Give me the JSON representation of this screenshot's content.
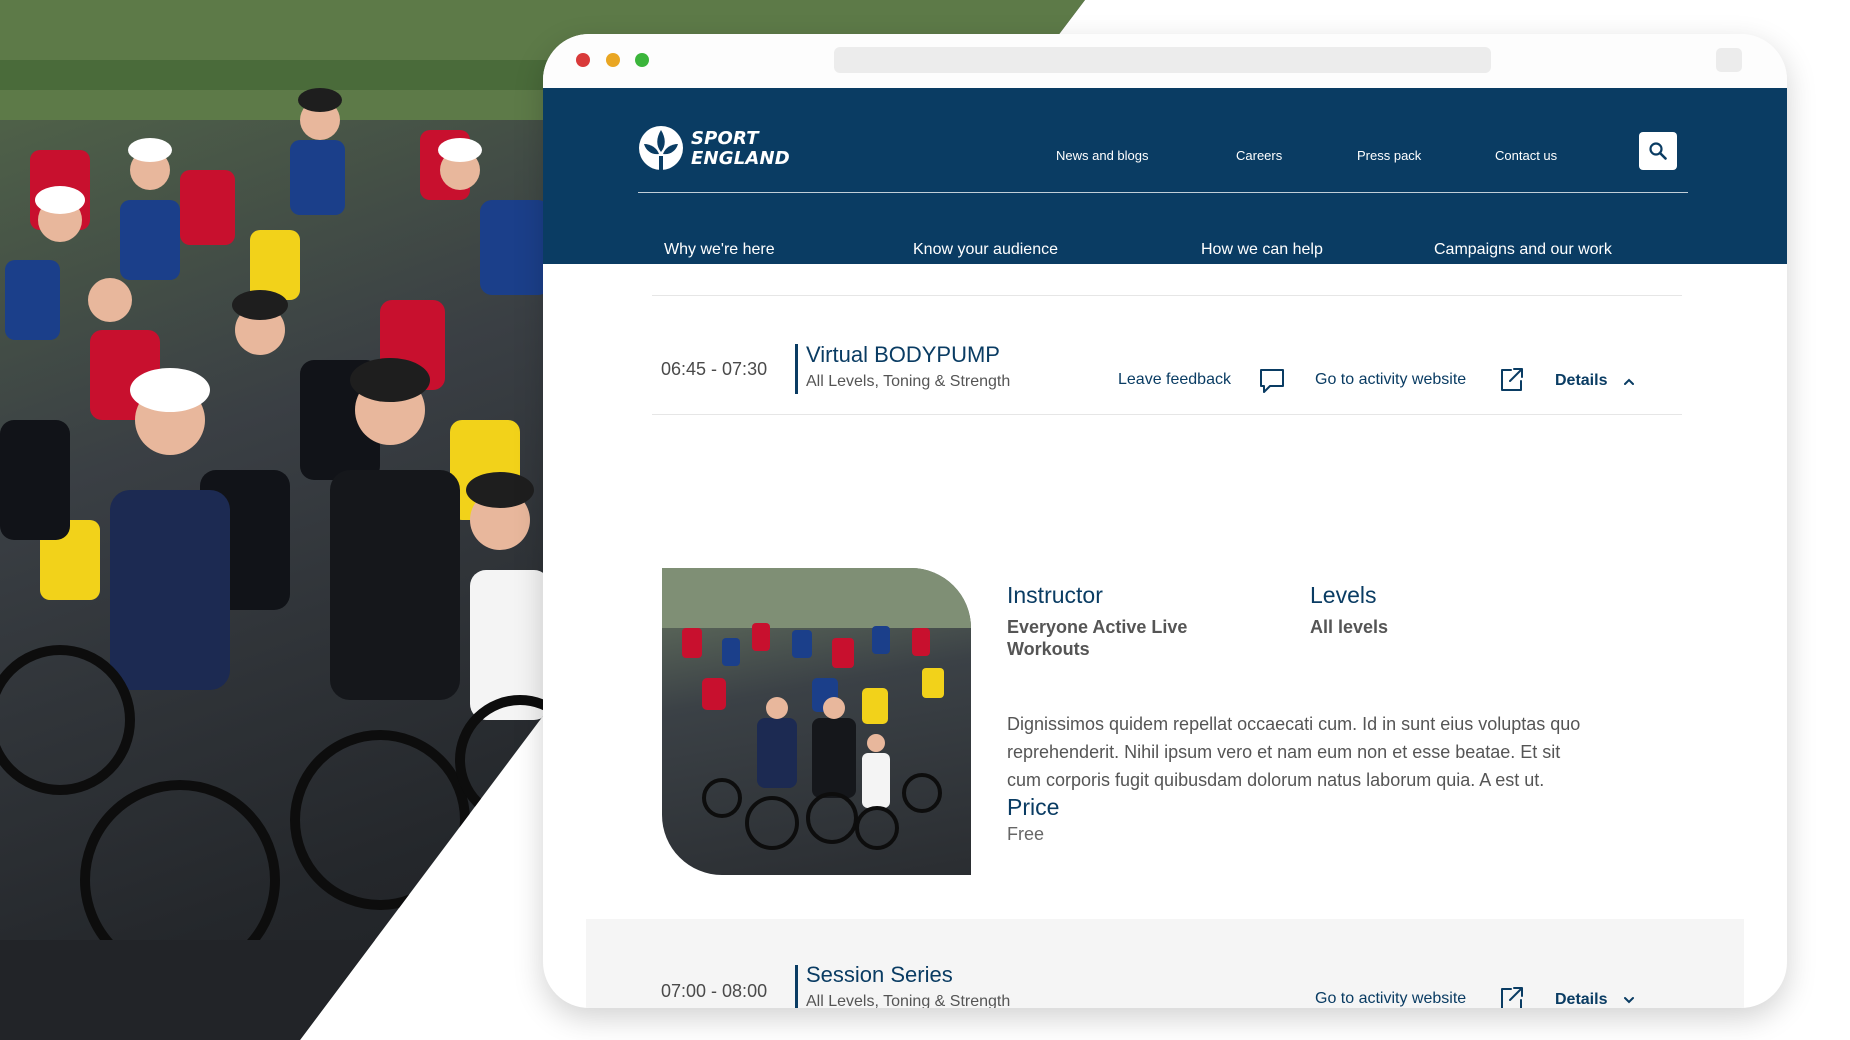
{
  "brand": {
    "line1": "SPORT",
    "line2": "ENGLAND"
  },
  "utility_nav": {
    "news": "News and blogs",
    "careers": "Careers",
    "press": "Press pack",
    "contact": "Contact us"
  },
  "main_nav": {
    "why": "Why we're here",
    "audience": "Know your audience",
    "help": "How we can help",
    "campaigns": "Campaigns and our work"
  },
  "sessions": [
    {
      "time": "06:45 - 07:30",
      "title": "Virtual BODYPUMP",
      "subtitle": "All Levels,  Toning & Strength",
      "feedback_label": "Leave feedback",
      "website_label": "Go to activity website",
      "details_label": "Details",
      "expanded": true
    },
    {
      "time": "07:00 - 08:00",
      "title": "Session Series",
      "subtitle": "All Levels, Toning & Strength",
      "website_label": "Go to activity website",
      "details_label": "Details",
      "expanded": false
    }
  ],
  "details": {
    "instructor_label": "Instructor",
    "instructor_value": "Everyone Active Live Workouts",
    "levels_label": "Levels",
    "levels_value": "All levels",
    "description": "Dignissimos quidem repellat occaecati cum. Id in sunt eius voluptas quo reprehenderit. Nihil ipsum vero et nam eum non et esse beatae. Et sit cum corporis fugit quibusdam dolorum natus laborum quia. A est ut.",
    "price_label": "Price",
    "price_value": "Free"
  },
  "colors": {
    "brand_navy": "#0a3c63",
    "row_background": "#f5f5f5",
    "divider": "#e6e6e6"
  },
  "icons": {
    "search": "search-icon",
    "feedback": "speech-bubble-icon",
    "external": "external-link-icon",
    "chevron_up": "chevron-up-icon",
    "chevron_down": "chevron-down-icon"
  }
}
